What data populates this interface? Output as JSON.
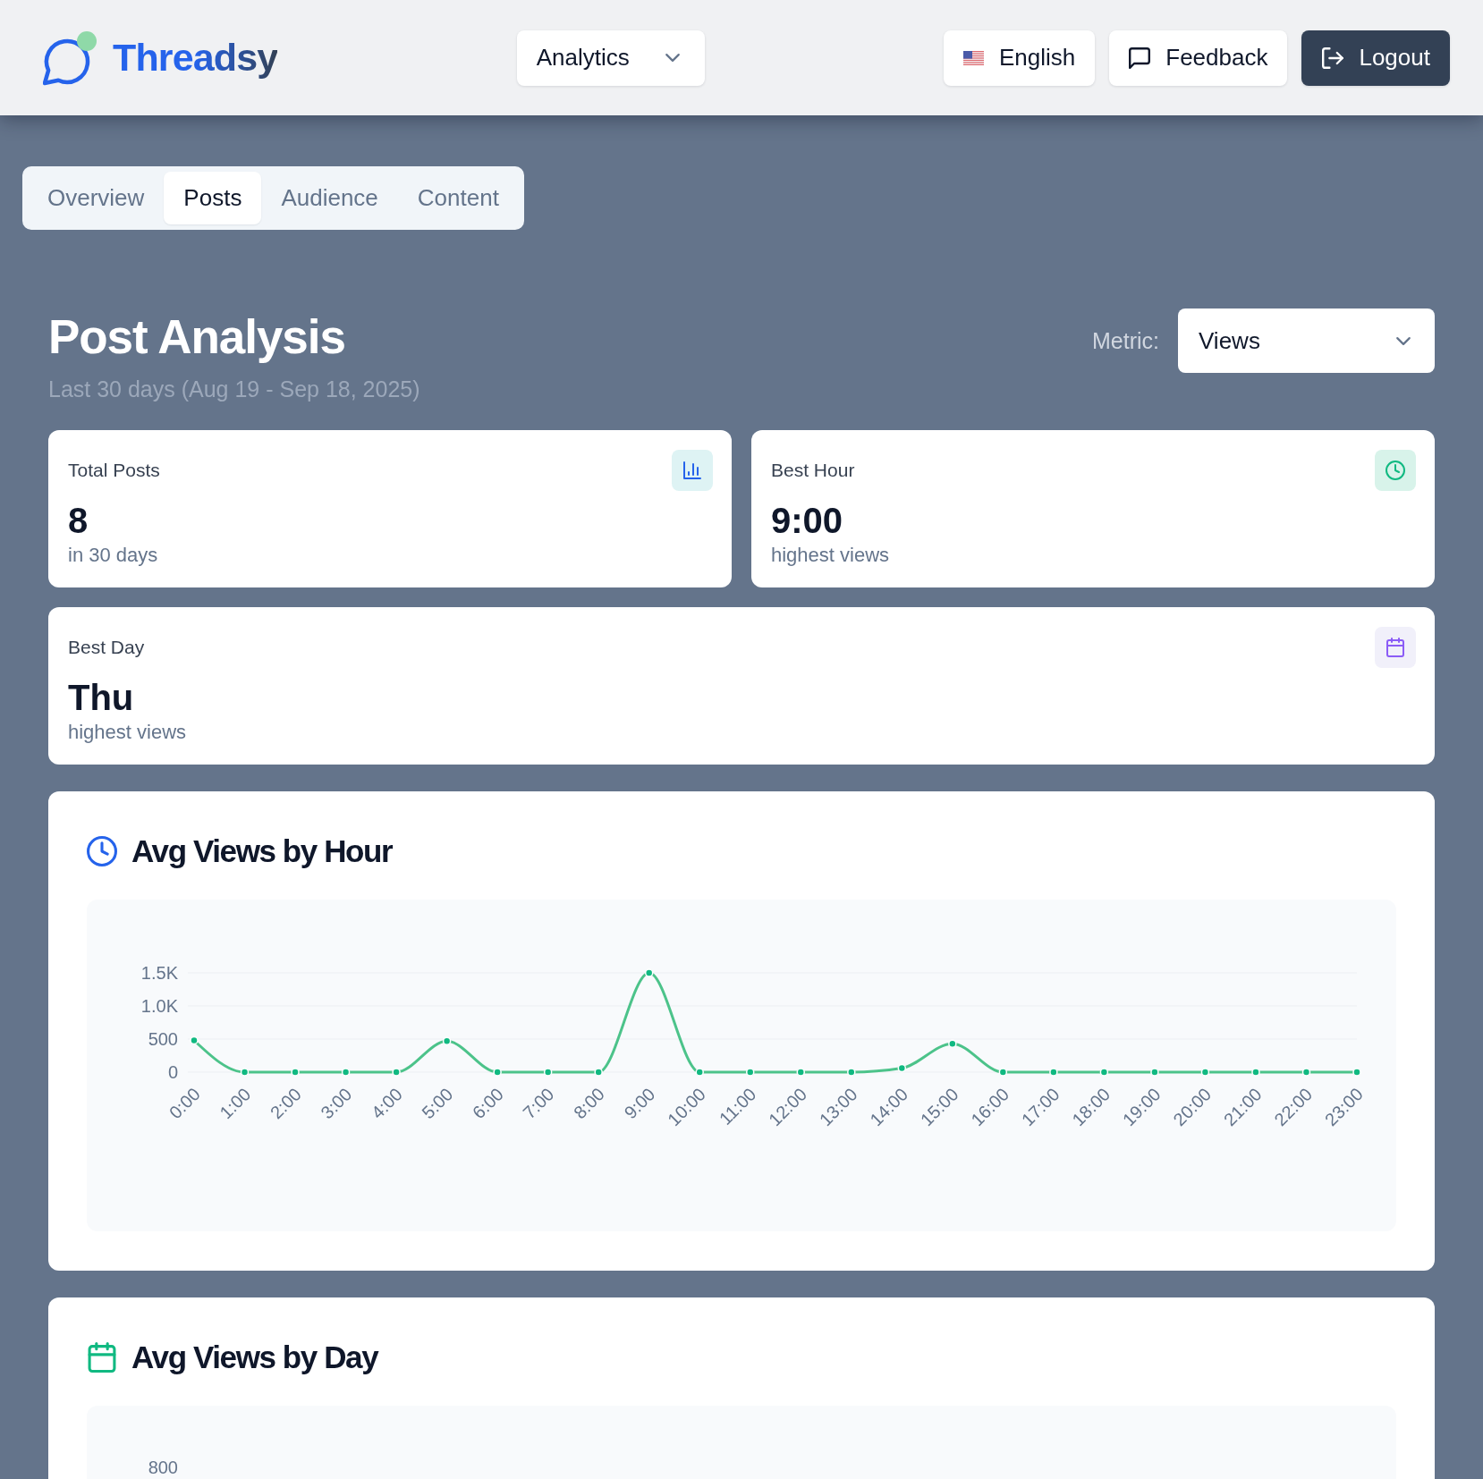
{
  "header": {
    "brand": "Threadsy",
    "section_select": {
      "value": "Analytics"
    },
    "buttons": [
      {
        "kind": "language",
        "label": "English"
      },
      {
        "kind": "feedback",
        "label": "Feedback"
      },
      {
        "kind": "logout",
        "label": "Logout"
      }
    ]
  },
  "tabs": [
    {
      "label": "Overview",
      "selected": false
    },
    {
      "label": "Posts",
      "selected": true
    },
    {
      "label": "Audience",
      "selected": false
    },
    {
      "label": "Content",
      "selected": false
    }
  ],
  "page": {
    "title": "Post Analysis",
    "subtitle": "Last 30 days (Aug 19 - Sep 18, 2025)",
    "metric": {
      "label": "Metric:",
      "value": "Views"
    }
  },
  "stat_cards": [
    {
      "kind": "posts",
      "label": "Total Posts",
      "value": "8",
      "caption": "in 30 days"
    },
    {
      "kind": "hour",
      "label": "Best Hour",
      "value": "9:00",
      "caption": "highest views"
    },
    {
      "kind": "day",
      "label": "Best Day",
      "value": "Thu",
      "caption": "highest views"
    }
  ],
  "charts": [
    {
      "kind": "hour",
      "title": "Avg Views by Hour",
      "chart_data": {
        "type": "line",
        "marker": true,
        "categories": [
          "0:00",
          "1:00",
          "2:00",
          "3:00",
          "4:00",
          "5:00",
          "6:00",
          "7:00",
          "8:00",
          "9:00",
          "10:00",
          "11:00",
          "12:00",
          "13:00",
          "14:00",
          "15:00",
          "16:00",
          "17:00",
          "18:00",
          "19:00",
          "20:00",
          "21:00",
          "22:00",
          "23:00"
        ],
        "values": [
          480,
          0,
          0,
          0,
          0,
          470,
          0,
          0,
          0,
          1500,
          0,
          0,
          0,
          0,
          60,
          430,
          0,
          0,
          0,
          0,
          0,
          0,
          0,
          0
        ],
        "ylim": [
          0,
          1500
        ],
        "yticks": [
          {
            "value": 0,
            "label": "0"
          },
          {
            "value": 500,
            "label": "500"
          },
          {
            "value": 1000,
            "label": "1.0K"
          },
          {
            "value": 1500,
            "label": "1.5K"
          }
        ]
      }
    },
    {
      "kind": "day",
      "title": "Avg Views by Day",
      "axis_labels": [
        "800"
      ]
    }
  ]
}
